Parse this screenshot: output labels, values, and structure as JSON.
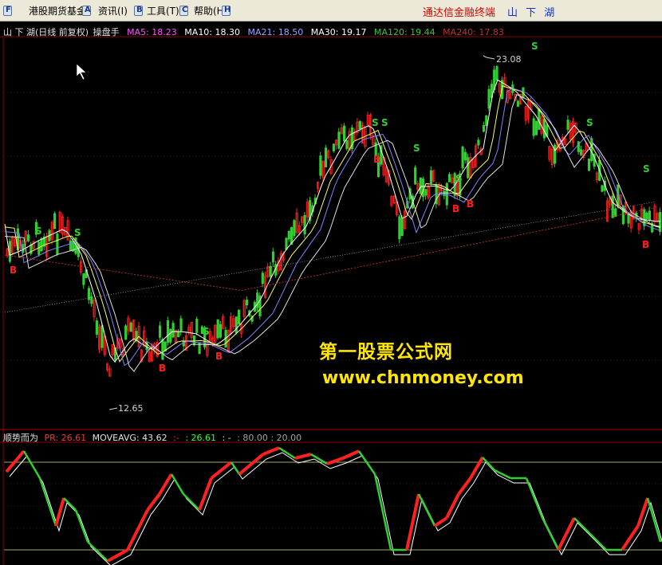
{
  "menu": {
    "items": [
      {
        "label": "港股期货基金"
      },
      {
        "label": "资讯(I)"
      },
      {
        "label": "工具(T)"
      },
      {
        "label": "帮助(H)"
      }
    ],
    "brand_red": "通达信金融终端",
    "brand_blue": "山 下 湖"
  },
  "main_chart": {
    "title": "山 下 湖(日线 前复权)",
    "indicator_name": "操盘手",
    "ma": [
      {
        "label": "MA5: 18.23",
        "color": "#ff50ff"
      },
      {
        "label": "MA10: 18.30",
        "color": "#ffffff"
      },
      {
        "label": "MA21: 18.50",
        "color": "#a0a0ff"
      },
      {
        "label": "MA30: 19.17",
        "color": "#ffffff"
      },
      {
        "label": "MA120: 19.44",
        "color": "#40c040"
      },
      {
        "label": "MA240: 17.83",
        "color": "#c03030"
      }
    ],
    "high_label": "23.08",
    "low_label": "12.65"
  },
  "indicator_panel": {
    "name": "顺势而为",
    "values": [
      {
        "label": "PR: 26.61",
        "color": "#ff3030"
      },
      {
        "label": "MOVEAVG: 43.62",
        "color": "#e0e0e0"
      },
      {
        "label": ":-",
        "color": "#ff3030"
      },
      {
        "label": ": 26.61",
        "color": "#30ff30"
      },
      {
        "label": ": -",
        "color": "#e0e0e0"
      },
      {
        "label": ": 80.00 : 20.00",
        "color": "#a0a0a0"
      }
    ]
  },
  "signals": {
    "buy": "B",
    "sell": "S"
  },
  "watermark": {
    "line1": "第一股票公式网",
    "line2": "www.chnmoney.com"
  },
  "colors": {
    "up": "#ff2020",
    "down": "#30d030",
    "sell_signal": "#30d030",
    "buy_signal": "#ff2020",
    "watermark": "#ffe600"
  }
}
